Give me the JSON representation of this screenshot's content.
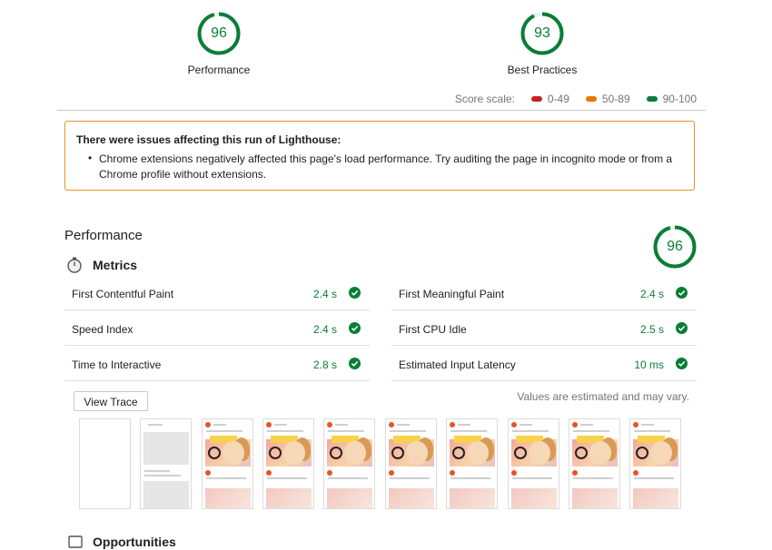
{
  "summary": {
    "gauges": [
      {
        "score": "96",
        "label": "Performance"
      },
      {
        "score": "93",
        "label": "Best Practices"
      }
    ],
    "score_scale": {
      "label": "Score scale:",
      "items": [
        {
          "range": "0-49",
          "color": "#c7221f"
        },
        {
          "range": "50-89",
          "color": "#e67700"
        },
        {
          "range": "90-100",
          "color": "#0a7d38"
        }
      ]
    }
  },
  "warning": {
    "title": "There were issues affecting this run of Lighthouse:",
    "message": "Chrome extensions negatively affected this page's load performance. Try auditing the page in incognito mode or from a Chrome profile without extensions."
  },
  "performance": {
    "heading": "Performance",
    "score": "96",
    "metrics_heading": "Metrics",
    "metrics": [
      {
        "name": "First Contentful Paint",
        "value": "2.4 s"
      },
      {
        "name": "First Meaningful Paint",
        "value": "2.4 s"
      },
      {
        "name": "Speed Index",
        "value": "2.4 s"
      },
      {
        "name": "First CPU Idle",
        "value": "2.5 s"
      },
      {
        "name": "Time to Interactive",
        "value": "2.8 s"
      },
      {
        "name": "Estimated Input Latency",
        "value": "10 ms"
      }
    ],
    "view_trace_label": "View Trace",
    "estimate_note": "Values are estimated and may vary.",
    "next_heading": "Opportunities"
  },
  "colors": {
    "pass": "#0a7d38",
    "warn_border": "#e8912a"
  }
}
